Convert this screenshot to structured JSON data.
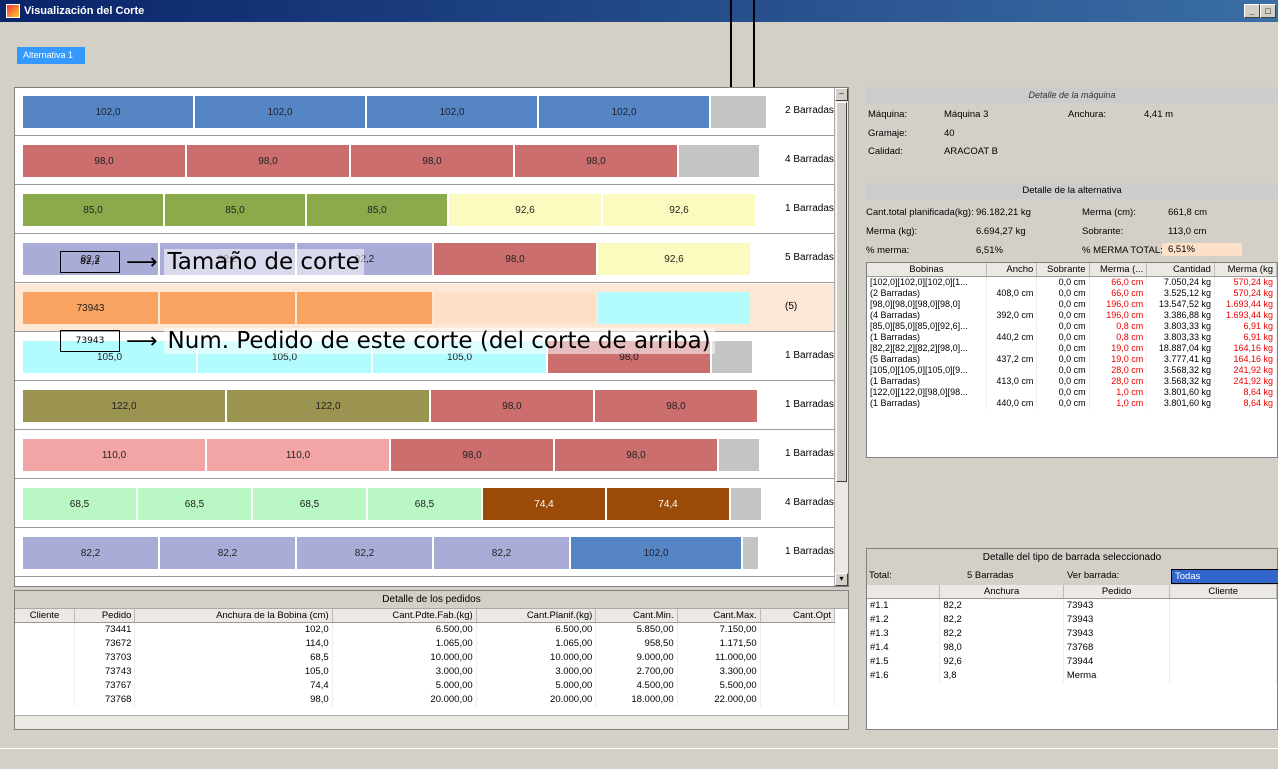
{
  "window": {
    "title": "Visualización del Corte",
    "btn_min": "_",
    "btn_close": "□"
  },
  "alt_tab": "Alternativa 1",
  "colors": {
    "blue": "#5585c5",
    "red": "#cc6e6e",
    "green": "#8aaa4c",
    "yellow": "#fbfbbf",
    "lavender": "#a9acd6",
    "orange": "#f9a361",
    "cyan": "#b2fcff",
    "olive": "#9a9450",
    "pink": "#f3a5a5",
    "lightgreen": "#b9f7c4",
    "brown": "#9c4a07",
    "gray": "#c4c4c4"
  },
  "cut_rows": [
    {
      "label": "2 Barradas",
      "segments": [
        {
          "v": "102,0",
          "c": "#5585c5",
          "w": 170
        },
        {
          "v": "102,0",
          "c": "#5585c5",
          "w": 170
        },
        {
          "v": "102,0",
          "c": "#5585c5",
          "w": 170
        },
        {
          "v": "102,0",
          "c": "#5585c5",
          "w": 170
        },
        {
          "v": "",
          "c": "#c4c4c4",
          "w": 55
        }
      ]
    },
    {
      "label": "4 Barradas",
      "segments": [
        {
          "v": "98,0",
          "c": "#cc6e6e",
          "w": 162
        },
        {
          "v": "98,0",
          "c": "#cc6e6e",
          "w": 162
        },
        {
          "v": "98,0",
          "c": "#cc6e6e",
          "w": 162
        },
        {
          "v": "98,0",
          "c": "#cc6e6e",
          "w": 162
        },
        {
          "v": "",
          "c": "#c4c4c4",
          "w": 80
        }
      ]
    },
    {
      "label": "1 Barradas",
      "segments": [
        {
          "v": "85,0",
          "c": "#8aaa4c",
          "w": 140
        },
        {
          "v": "85,0",
          "c": "#8aaa4c",
          "w": 140
        },
        {
          "v": "85,0",
          "c": "#8aaa4c",
          "w": 140
        },
        {
          "v": "92,6",
          "c": "#fbfbbf",
          "w": 152
        },
        {
          "v": "92,6",
          "c": "#fbfbbf",
          "w": 152
        }
      ]
    },
    {
      "label": "5 Barradas",
      "segments": [
        {
          "v": "82,2",
          "c": "#a9acd6",
          "w": 135
        },
        {
          "v": "82,2",
          "c": "#a9acd6",
          "w": 135
        },
        {
          "v": "82,2",
          "c": "#a9acd6",
          "w": 135
        },
        {
          "v": "98,0",
          "c": "#cc6e6e",
          "w": 162
        },
        {
          "v": "92,6",
          "c": "#fbfbbf",
          "w": 152
        }
      ]
    },
    {
      "label": "(5)",
      "segments": [
        {
          "v": "73943",
          "c": "#f9a361",
          "w": 135
        },
        {
          "v": "",
          "c": "#f9a361",
          "w": 135
        },
        {
          "v": "",
          "c": "#f9a361",
          "w": 135
        },
        {
          "v": "",
          "c": "#fce0c8",
          "w": 162
        },
        {
          "v": "",
          "c": "#b2fcff",
          "w": 152
        }
      ]
    },
    {
      "label": "1 Barradas",
      "segments": [
        {
          "v": "105,0",
          "c": "#b2fcff",
          "w": 173
        },
        {
          "v": "105,0",
          "c": "#b2fcff",
          "w": 173
        },
        {
          "v": "105,0",
          "c": "#b2fcff",
          "w": 173
        },
        {
          "v": "98,0",
          "c": "#cc6e6e",
          "w": 162
        },
        {
          "v": "",
          "c": "#c4c4c4",
          "w": 40
        }
      ]
    },
    {
      "label": "1 Barradas",
      "segments": [
        {
          "v": "122,0",
          "c": "#9a9450",
          "w": 202
        },
        {
          "v": "122,0",
          "c": "#9a9450",
          "w": 202
        },
        {
          "v": "98,0",
          "c": "#cc6e6e",
          "w": 162
        },
        {
          "v": "98,0",
          "c": "#cc6e6e",
          "w": 162
        }
      ]
    },
    {
      "label": "1 Barradas",
      "segments": [
        {
          "v": "110,0",
          "c": "#f3a5a5",
          "w": 182
        },
        {
          "v": "110,0",
          "c": "#f3a5a5",
          "w": 182
        },
        {
          "v": "98,0",
          "c": "#cc6e6e",
          "w": 162
        },
        {
          "v": "98,0",
          "c": "#cc6e6e",
          "w": 162
        },
        {
          "v": "",
          "c": "#c4c4c4",
          "w": 40
        }
      ]
    },
    {
      "label": "4 Barradas",
      "segments": [
        {
          "v": "68,5",
          "c": "#b9f7c4",
          "w": 113
        },
        {
          "v": "68,5",
          "c": "#b9f7c4",
          "w": 113
        },
        {
          "v": "68,5",
          "c": "#b9f7c4",
          "w": 113
        },
        {
          "v": "68,5",
          "c": "#b9f7c4",
          "w": 113
        },
        {
          "v": "74,4",
          "c": "#9c4a07",
          "w": 122
        },
        {
          "v": "74,4",
          "c": "#9c4a07",
          "w": 122
        },
        {
          "v": "",
          "c": "#c4c4c4",
          "w": 30
        }
      ]
    },
    {
      "label": "1 Barradas",
      "segments": [
        {
          "v": "82,2",
          "c": "#a9acd6",
          "w": 135
        },
        {
          "v": "82,2",
          "c": "#a9acd6",
          "w": 135
        },
        {
          "v": "82,2",
          "c": "#a9acd6",
          "w": 135
        },
        {
          "v": "82,2",
          "c": "#a9acd6",
          "w": 135
        },
        {
          "v": "102,0",
          "c": "#5585c5",
          "w": 170
        },
        {
          "v": "",
          "c": "#c4c4c4",
          "w": 15
        }
      ]
    }
  ],
  "annotations": {
    "size_box": "82,2",
    "size_text": "Tamaño de corte",
    "order_box": "73943",
    "order_text": "Num. Pedido de este corte (del corte de arriba)",
    "arrow": "⟶"
  },
  "orders": {
    "title": "Detalle de los pedidos",
    "columns": [
      "Cliente",
      "Pedido",
      "Anchura de la Bobina (cm)",
      "Cant.Pdte.Fab.(kg)",
      "Cant.Planif.(kg)",
      "Cant.Min.",
      "Cant.Max.",
      "Cant.Opt"
    ],
    "rows": [
      [
        "",
        "73441",
        "102,0",
        "6.500,00",
        "6.500,00",
        "5.850,00",
        "7.150,00",
        ""
      ],
      [
        "",
        "73672",
        "114,0",
        "1.065,00",
        "1.065,00",
        "958,50",
        "1.171,50",
        ""
      ],
      [
        "",
        "73703",
        "68,5",
        "10.000,00",
        "10.000,00",
        "9.000,00",
        "11.000,00",
        ""
      ],
      [
        "",
        "73743",
        "105,0",
        "3.000,00",
        "3.000,00",
        "2.700,00",
        "3.300,00",
        ""
      ],
      [
        "",
        "73767",
        "74,4",
        "5.000,00",
        "5.000,00",
        "4.500,00",
        "5.500,00",
        ""
      ],
      [
        "",
        "73768",
        "98,0",
        "20.000,00",
        "20.000,00",
        "18.000,00",
        "22.000,00",
        ""
      ]
    ]
  },
  "machine": {
    "title": "Detalle de la máquina",
    "maquina_label": "Máquina:",
    "maquina": "Máquina 3",
    "anchura_label": "Anchura:",
    "anchura": "4,41 m",
    "gramaje_label": "Gramaje:",
    "gramaje": "40",
    "calidad_label": "Calidad:",
    "calidad": "ARACOAT B"
  },
  "alternative": {
    "title": "Detalle de la alternativa",
    "total_label": "Cant.total planificada(kg):",
    "total": "96.182,21 kg",
    "mermacm_label": "Merma (cm):",
    "mermacm": "661,8 cm",
    "mermakg_label": "Merma (kg):",
    "mermakg": "6.694,27 kg",
    "sobrante_label": "Sobrante:",
    "sobrante": "113,0 cm",
    "pmerma_label": "% merma:",
    "pmerma": "6,51%",
    "pmermatot_label": "% MERMA TOTAL:",
    "pmermatot": "6,51%"
  },
  "bobinas": {
    "columns": [
      "Bobinas",
      "Ancho",
      "Sobrante",
      "Merma (...",
      "Cantidad",
      "Merma (kg"
    ],
    "rows": [
      [
        "[102,0][102,0][102,0][1...",
        "",
        "0,0 cm",
        "66,0 cm",
        "7.050,24 kg",
        "570,24 kg"
      ],
      [
        "(2 Barradas)",
        "408,0 cm",
        "0,0 cm",
        "66,0 cm",
        "3.525,12 kg",
        "570,24 kg"
      ],
      [
        "[98,0][98,0][98,0][98,0]",
        "",
        "0,0 cm",
        "196,0 cm",
        "13.547,52 kg",
        "1.693,44 kg"
      ],
      [
        "(4 Barradas)",
        "392,0 cm",
        "0,0 cm",
        "196,0 cm",
        "3.386,88 kg",
        "1.693,44 kg"
      ],
      [
        "[85,0][85,0][85,0][92,6]...",
        "",
        "0,0 cm",
        "0,8 cm",
        "3.803,33 kg",
        "6,91 kg"
      ],
      [
        "(1 Barradas)",
        "440,2 cm",
        "0,0 cm",
        "0,8 cm",
        "3.803,33 kg",
        "6,91 kg"
      ],
      [
        "[82,2][82,2][82,2][98,0]...",
        "",
        "0,0 cm",
        "19,0 cm",
        "18.887,04 kg",
        "164,16 kg"
      ],
      [
        "(5 Barradas)",
        "437,2 cm",
        "0,0 cm",
        "19,0 cm",
        "3.777,41 kg",
        "164,16 kg"
      ],
      [
        "[105,0][105,0][105,0][9...",
        "",
        "0,0 cm",
        "28,0 cm",
        "3.568,32 kg",
        "241,92 kg"
      ],
      [
        "(1 Barradas)",
        "413,0 cm",
        "0,0 cm",
        "28,0 cm",
        "3.568,32 kg",
        "241,92 kg"
      ],
      [
        "[122,0][122,0][98,0][98...",
        "",
        "0,0 cm",
        "1,0 cm",
        "3.801,60 kg",
        "8,64 kg"
      ],
      [
        "(1 Barradas)",
        "440,0 cm",
        "0,0 cm",
        "1,0 cm",
        "3.801,60 kg",
        "8,64 kg"
      ]
    ]
  },
  "selected_type": {
    "title": "Detalle del tipo de barrada seleccionado",
    "total_label": "Total:",
    "total": "5 Barradas",
    "ver_label": "Ver barrada:",
    "ver_value": "Todas",
    "columns": [
      "",
      "Anchura",
      "Pedido",
      "Cliente"
    ],
    "rows": [
      [
        "#1.1",
        "82,2",
        "73943",
        ""
      ],
      [
        "#1.2",
        "82,2",
        "73943",
        ""
      ],
      [
        "#1.3",
        "82,2",
        "73943",
        ""
      ],
      [
        "#1.4",
        "98,0",
        "73768",
        ""
      ],
      [
        "#1.5",
        "92,6",
        "73944",
        ""
      ],
      [
        "#1.6",
        "3,8",
        "Merma",
        ""
      ]
    ]
  }
}
